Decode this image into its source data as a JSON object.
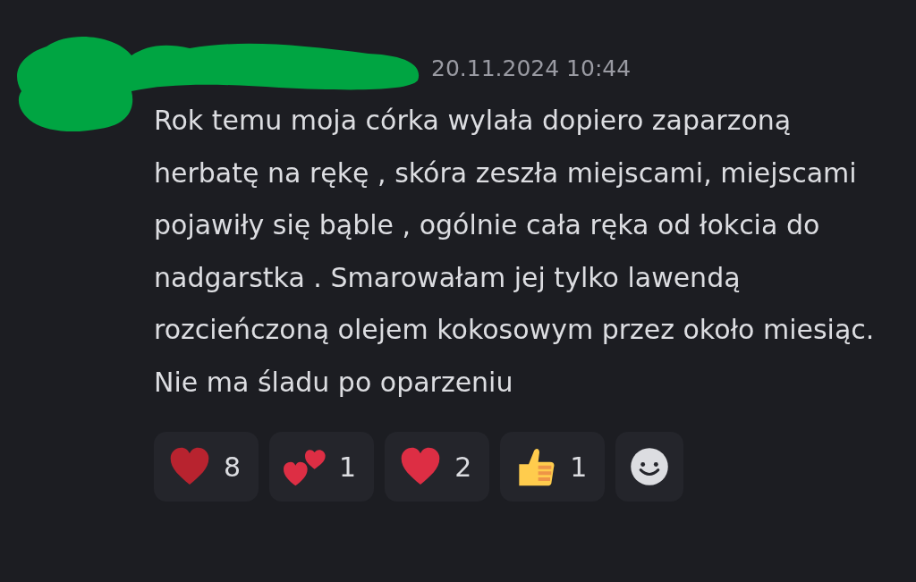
{
  "message": {
    "timestamp": "20.11.2024 10:44",
    "text": "Rok temu moja córka wylała dopiero zaparzoną herbatę na rękę , skóra zeszła miejscami, miejscami pojawiły się bąble , ogólnie cała ręka od łokcia do nadgarstka . Smarowałam jej tylko lawendą rozcieńczoną olejem kokosowym przez około miesiąc. Nie ma śladu po oparzeniu",
    "reactions": [
      {
        "kind": "heart",
        "color": "#b8232f",
        "count": "8"
      },
      {
        "kind": "two-hearts",
        "color": "#dd2e44",
        "count": "1"
      },
      {
        "kind": "heart",
        "color": "#dd2e44",
        "count": "2"
      },
      {
        "kind": "thumbs-up",
        "color": "#ffcc4d",
        "count": "1"
      },
      {
        "kind": "add-reaction",
        "color": "#dcdde1"
      }
    ]
  }
}
